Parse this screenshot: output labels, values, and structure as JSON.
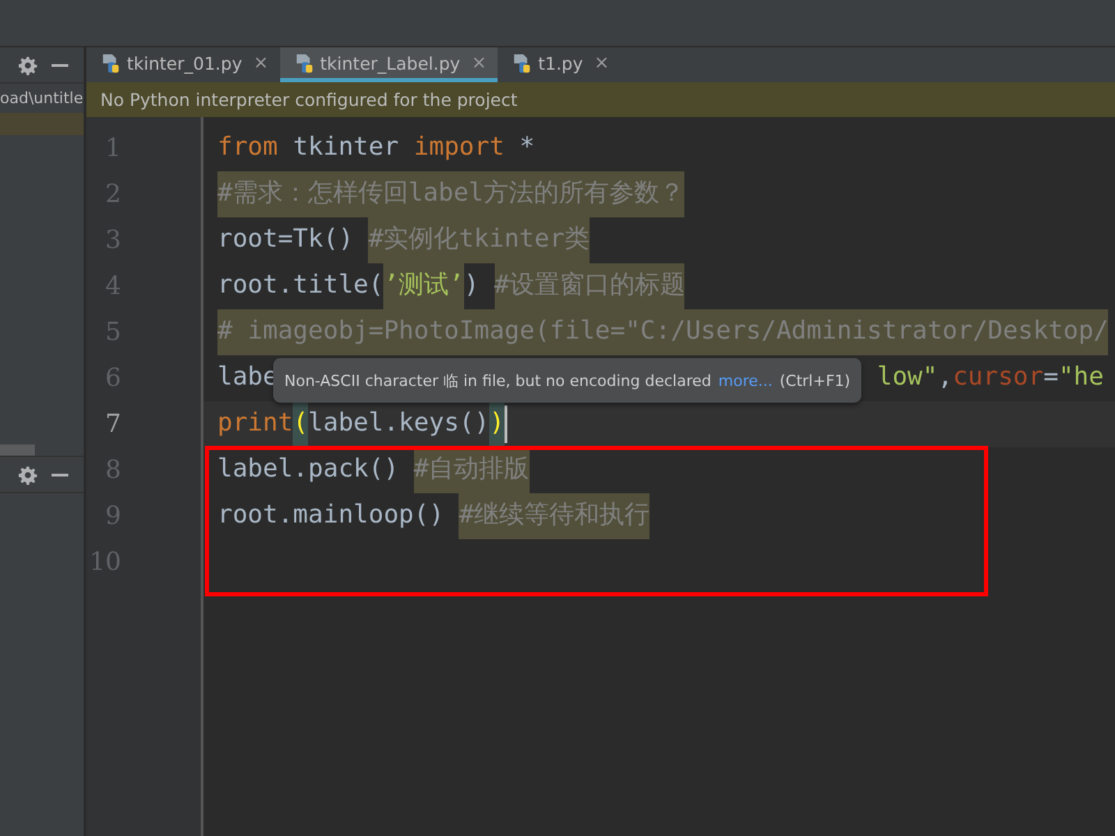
{
  "left_panel": {
    "path": "oad\\untitle"
  },
  "tabs": [
    {
      "label": "tkinter_01.py",
      "selected": false,
      "close": "×"
    },
    {
      "label": "tkinter_Label.py",
      "selected": true,
      "close": "×"
    },
    {
      "label": "t1.py",
      "selected": false,
      "close": "×"
    }
  ],
  "banner": "No Python interpreter configured for the project",
  "editor": {
    "lines": [
      {
        "number": "1",
        "current": false,
        "tokens": [
          {
            "kind": "keyword",
            "text": "from"
          },
          {
            "kind": "plain",
            "text": " tkinter "
          },
          {
            "kind": "keyword",
            "text": "import"
          },
          {
            "kind": "plain",
            "text": " *"
          }
        ]
      },
      {
        "number": "2",
        "current": false,
        "tokens": [
          {
            "kind": "comment",
            "text": "#需求：怎样传回label方法的所有参数？",
            "highlighted": true
          }
        ]
      },
      {
        "number": "3",
        "current": false,
        "tokens": [
          {
            "kind": "plain",
            "text": "root=Tk() "
          },
          {
            "kind": "comment",
            "text": "#实例化tkinter类",
            "highlighted": true
          }
        ]
      },
      {
        "number": "4",
        "current": false,
        "tokens": [
          {
            "kind": "plain",
            "text": "root.title("
          },
          {
            "kind": "string",
            "text": "’测试’",
            "highlighted": true
          },
          {
            "kind": "plain",
            "text": ") "
          },
          {
            "kind": "comment",
            "text": "#设置窗口的标题",
            "highlighted": true
          }
        ]
      },
      {
        "number": "5",
        "current": false,
        "tokens": [
          {
            "kind": "comment",
            "text": "# imageobj=PhotoImage(file=\"C:/Users/Administrator/Desktop/",
            "highlighted": true
          }
        ]
      },
      {
        "number": "6",
        "current": false,
        "tokens": [
          {
            "kind": "plain",
            "text": "labe"
          },
          {
            "kind": "gap"
          },
          {
            "kind": "string",
            "text": "low\""
          },
          {
            "kind": "plain",
            "text": ","
          },
          {
            "kind": "param",
            "text": "cursor"
          },
          {
            "kind": "plain",
            "text": "="
          },
          {
            "kind": "string",
            "text": "\"he"
          }
        ]
      },
      {
        "number": "7",
        "current": true,
        "tokens": [
          {
            "kind": "builtin",
            "text": "print"
          },
          {
            "kind": "brace",
            "text": "(",
            "highlighted": true
          },
          {
            "kind": "plain",
            "text": "label.keys()"
          },
          {
            "kind": "brace",
            "text": ")",
            "highlighted": true
          }
        ]
      },
      {
        "number": "8",
        "current": false,
        "tokens": [
          {
            "kind": "plain",
            "text": "label.pack() "
          },
          {
            "kind": "comment",
            "text": "#自动排版",
            "highlighted": true
          }
        ]
      },
      {
        "number": "9",
        "current": false,
        "tokens": [
          {
            "kind": "plain",
            "text": "root.mainloop() "
          },
          {
            "kind": "comment",
            "text": "#继续等待和执行",
            "highlighted": true
          }
        ]
      },
      {
        "number": "10",
        "current": false
      }
    ]
  },
  "tooltip": {
    "text": "Non-ASCII character 临 in file, but no encoding declared",
    "link": "more...",
    "shortcut": "(Ctrl+F1)"
  }
}
